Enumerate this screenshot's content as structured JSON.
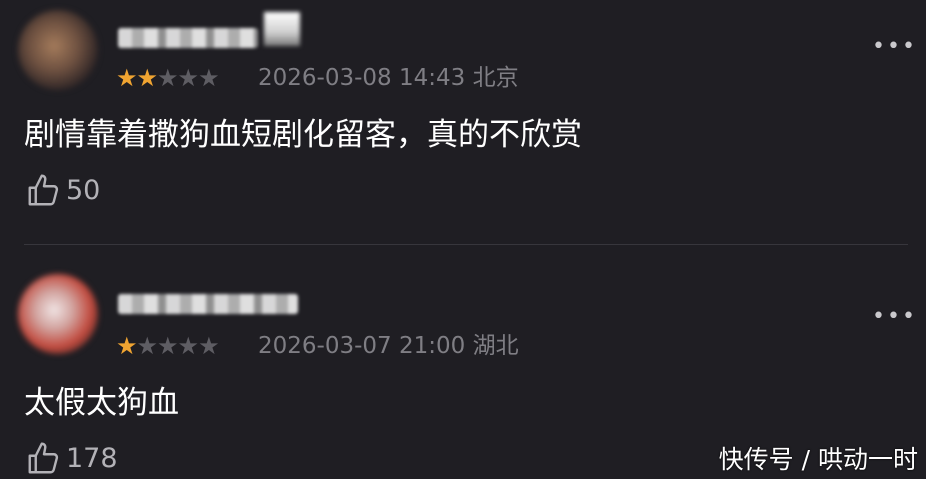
{
  "comments": [
    {
      "rating": 2,
      "stars": {
        "filled": "★★",
        "empty": "★★★"
      },
      "meta": "2026-03-08 14:43 北京",
      "text": "剧情靠着撒狗血短剧化留客，真的不欣赏",
      "likes": "50",
      "more": "•••"
    },
    {
      "rating": 1,
      "stars": {
        "filled": "★",
        "empty": "★★★★"
      },
      "meta": "2026-03-07 21:00 湖北",
      "text": "太假太狗血",
      "likes": "178",
      "more": "•••"
    }
  ],
  "watermark": "快传号 / 哄动一时",
  "colors": {
    "background": "#1f1e23",
    "star_filled": "#f0a431",
    "star_empty": "#5e5d63",
    "meta": "#7f7e84"
  }
}
